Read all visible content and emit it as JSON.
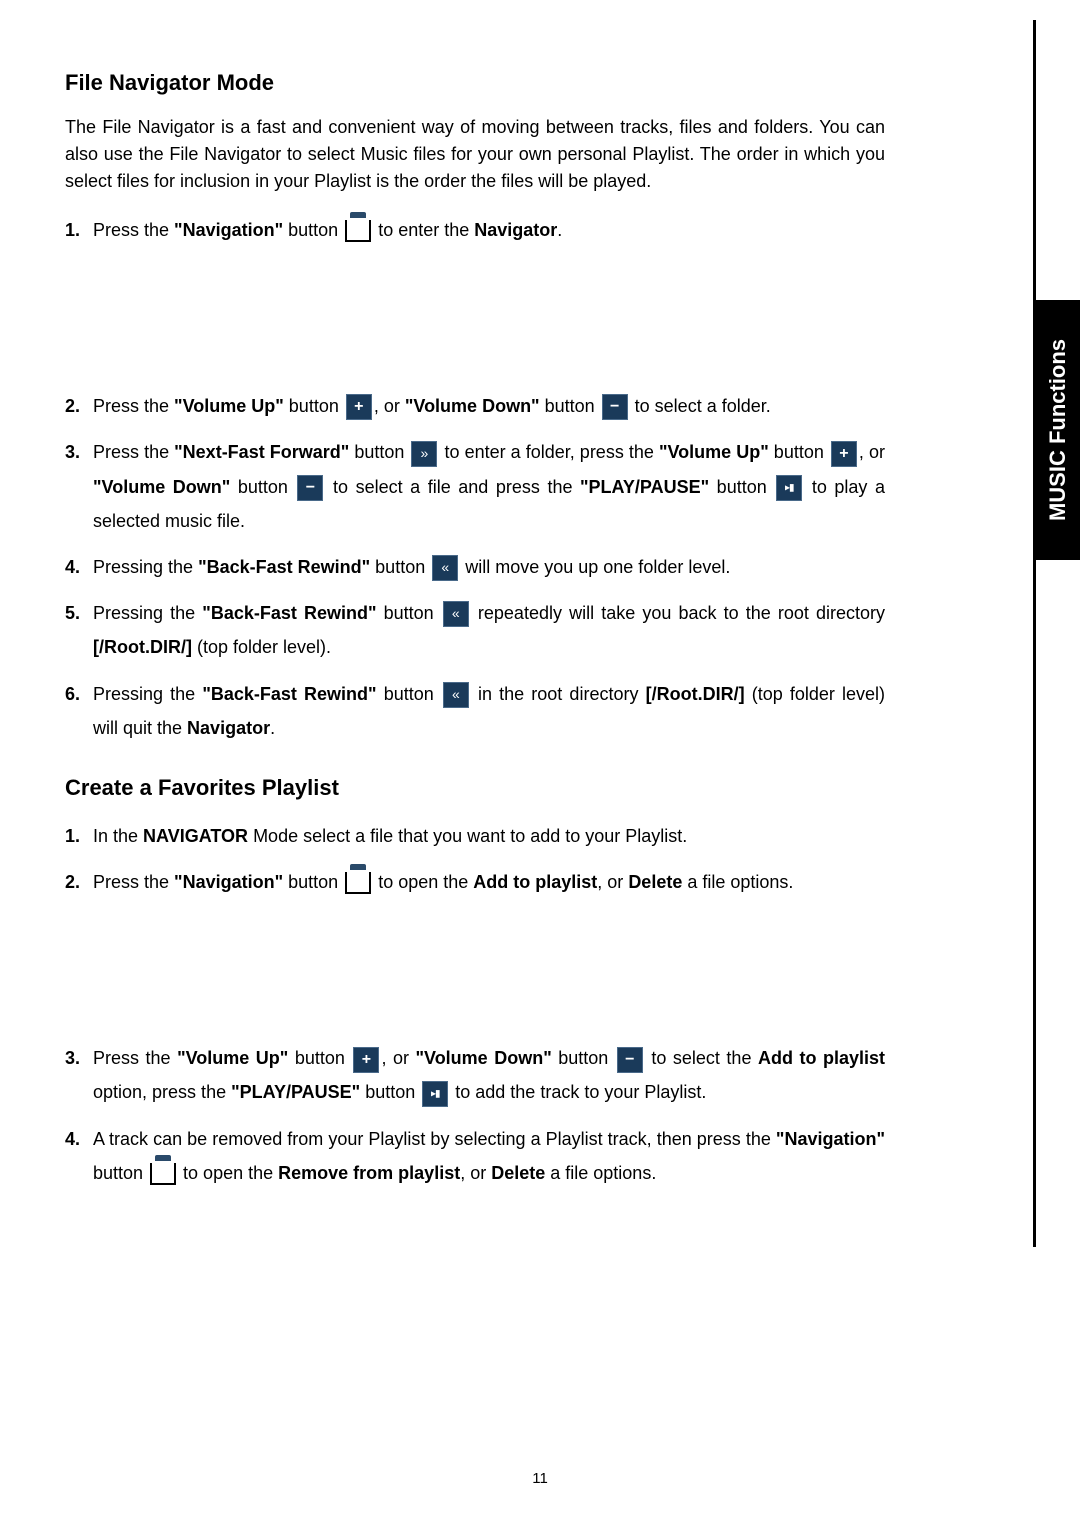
{
  "sideTab": "MUSIC Functions",
  "pageNumber": "11",
  "section1": {
    "heading": "File Navigator Mode",
    "intro": "The File Navigator is a fast and convenient way of moving between tracks, files and folders. You can also use the File Navigator to select Music files for your own personal Playlist. The order in which you select files for inclusion in your Playlist is the order the files will be played.",
    "items": {
      "i1a": "Press the ",
      "i1b": "\"Navigation\"",
      "i1c": " button ",
      "i1d": " to enter the ",
      "i1e": "Navigator",
      "i1f": ".",
      "i2a": "Press the ",
      "i2b": "\"Volume Up\"",
      "i2c": " button ",
      "i2d": ", or ",
      "i2e": "\"Volume Down\"",
      "i2f": " button ",
      "i2g": " to select a folder.",
      "i3a": "Press the ",
      "i3b": "\"Next-Fast Forward\"",
      "i3c": " button ",
      "i3d": " to enter a folder, press the ",
      "i3e": "\"Volume Up\"",
      "i3f": " button ",
      "i3g": ", or ",
      "i3h": "\"Volume Down\"",
      "i3i": " button ",
      "i3j": " to select a file and press the ",
      "i3k": "\"PLAY/PAUSE\"",
      "i3l": " button ",
      "i3m": " to play a selected music file.",
      "i4a": "Pressing the ",
      "i4b": "\"Back-Fast Rewind\"",
      "i4c": " button ",
      "i4d": " will move you up one folder level.",
      "i5a": "Pressing the ",
      "i5b": "\"Back-Fast Rewind\"",
      "i5c": " button ",
      "i5d": " repeatedly will take you back to the root directory ",
      "i5e": "[/Root.DIR/]",
      "i5f": " (top folder level).",
      "i6a": "Pressing the ",
      "i6b": "\"Back-Fast Rewind\"",
      "i6c": " button ",
      "i6d": " in the root directory ",
      "i6e": "[/Root.DIR/]",
      "i6f": " (top folder level) will quit the ",
      "i6g": "Navigator",
      "i6h": "."
    }
  },
  "section2": {
    "heading": "Create a Favorites Playlist",
    "items": {
      "i1a": "In the ",
      "i1b": "NAVIGATOR",
      "i1c": " Mode select a file that you want to add to your Playlist.",
      "i2a": "Press the ",
      "i2b": "\"Navigation\"",
      "i2c": " button ",
      "i2d": " to open the ",
      "i2e": "Add to playlist",
      "i2f": ", or ",
      "i2g": "Delete",
      "i2h": " a file options.",
      "i3a": "Press the ",
      "i3b": "\"Volume Up\"",
      "i3c": " button ",
      "i3d": ", or ",
      "i3e": "\"Volume Down\"",
      "i3f": " button ",
      "i3g": " to select the ",
      "i3h": "Add to playlist",
      "i3i": " option, press the ",
      "i3j": "\"PLAY/PAUSE\"",
      "i3k": " button ",
      "i3l": " to add the track to your Playlist.",
      "i4a": "A track can be removed from your Playlist by selecting a Playlist track, then press the ",
      "i4b": "\"Navigation\"",
      "i4c": " button ",
      "i4d": " to open the ",
      "i4e": "Remove from playlist",
      "i4f": ", or ",
      "i4g": "Delete",
      "i4h": " a file options."
    }
  }
}
